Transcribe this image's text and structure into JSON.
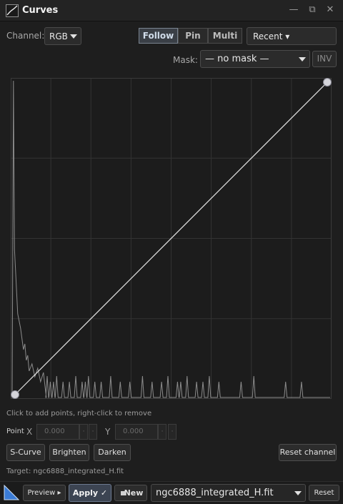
{
  "window": {
    "title": "Curves",
    "minimize_glyph": "—",
    "popout_glyph": "⧉",
    "close_glyph": "✕"
  },
  "channel": {
    "label": "Channel:",
    "value": "RGB"
  },
  "mode_buttons": [
    {
      "label": "Follow",
      "active": true
    },
    {
      "label": "Pin",
      "active": false
    },
    {
      "label": "Multi",
      "active": false
    }
  ],
  "recent": {
    "label": "Recent ▾"
  },
  "mask": {
    "label": "Mask:",
    "value": "— no mask —",
    "inv_label": "INV"
  },
  "hint": "Click to add points, right-click to remove",
  "point": {
    "label": "Point",
    "x_label": "X",
    "x_value": "0.000",
    "y_label": "Y",
    "y_value": "0.000",
    "spin_glyph": "·"
  },
  "presets": {
    "s_curve": "S-Curve",
    "brighten": "Brighten",
    "darken": "Darken",
    "reset_channel": "Reset channel"
  },
  "target_text": "Target: ngc6888_integrated_H.fit",
  "bottom": {
    "preview_label": "Preview ▸",
    "apply_label": "Apply ✓",
    "new_label": "New",
    "file_value": "ngc6888_integrated_H.fit",
    "reset_label": "Reset"
  },
  "colors": {
    "curve": "#e6e6e6",
    "histogram": "#8c8c8c",
    "grid": "#333333",
    "handle": "#d4d4da"
  },
  "curve_points": [
    {
      "x": 0.0,
      "y": 0.0
    },
    {
      "x": 1.0,
      "y": 1.0
    }
  ],
  "histogram": {
    "peak_x": 0.004,
    "spikes": [
      0.11,
      0.12,
      0.13,
      0.14,
      0.16,
      0.18,
      0.2,
      0.22,
      0.23,
      0.24,
      0.26,
      0.28,
      0.31,
      0.34,
      0.37,
      0.41,
      0.44,
      0.47,
      0.49,
      0.52,
      0.53,
      0.55,
      0.58,
      0.6,
      0.62,
      0.65,
      0.72,
      0.76,
      0.86,
      0.91
    ]
  }
}
